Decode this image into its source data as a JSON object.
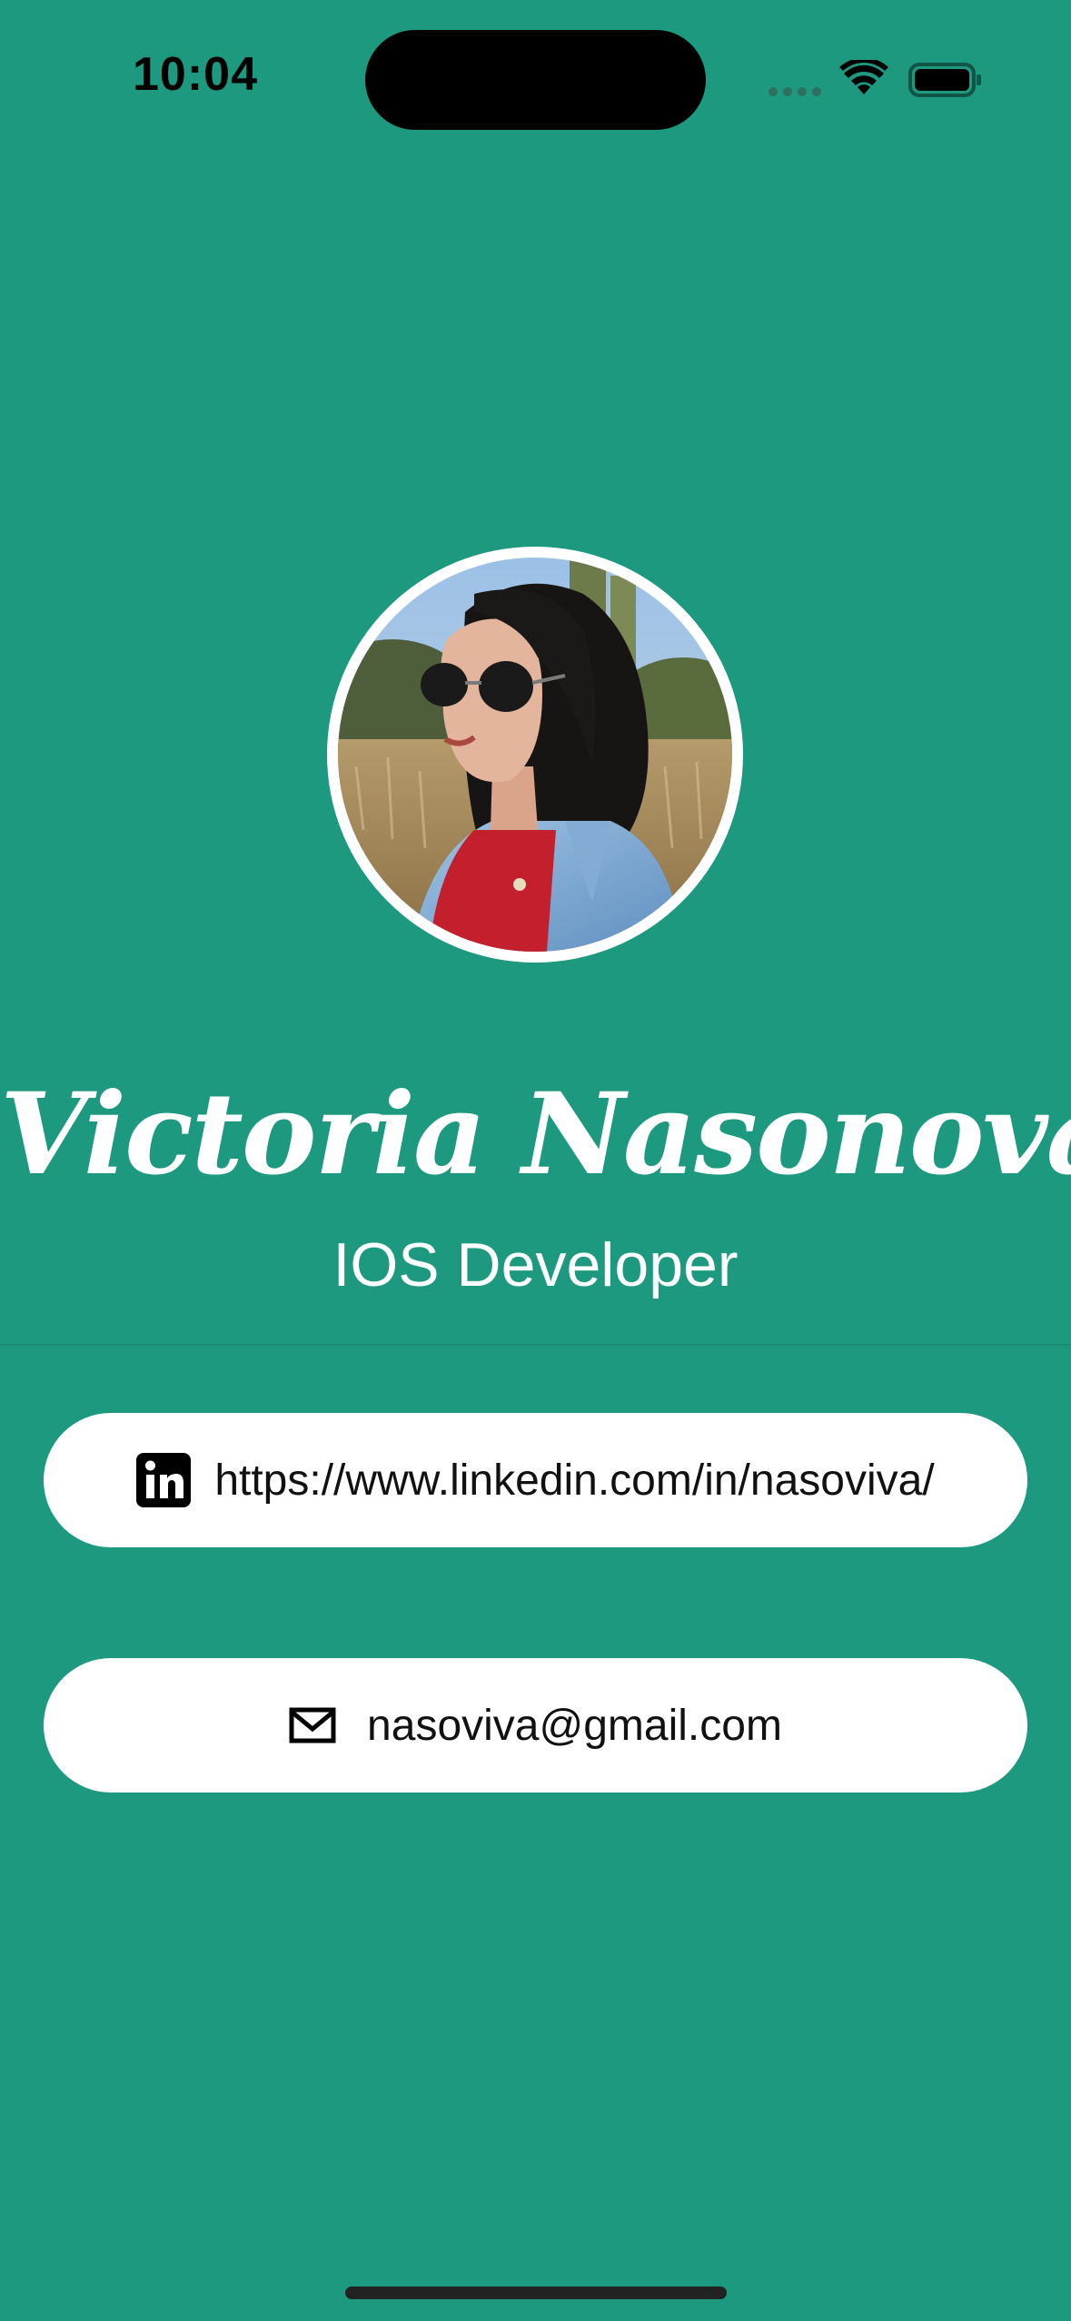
{
  "status_bar": {
    "time": "10:04"
  },
  "profile": {
    "name": "Victoria Nasonova",
    "title": "IOS Developer"
  },
  "contacts": {
    "linkedin": {
      "icon": "linkedin-icon",
      "text": "https://www.linkedin.com/in/nasoviva/"
    },
    "email": {
      "icon": "envelope-icon",
      "text": "nasoviva@gmail.com"
    }
  },
  "colors": {
    "background": "#1c997e",
    "pill": "#ffffff",
    "text_on_background": "#ffffff"
  }
}
